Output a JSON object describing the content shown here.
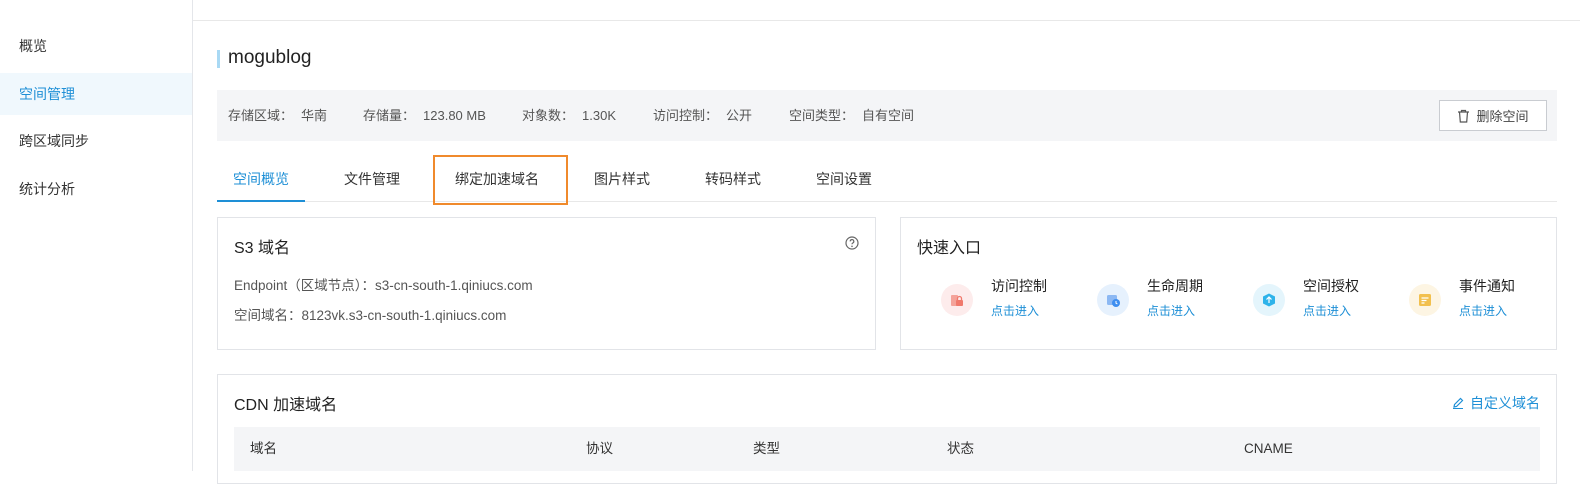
{
  "sidebar": {
    "items": [
      {
        "label": "概览",
        "active": false
      },
      {
        "label": "空间管理",
        "active": true
      },
      {
        "label": "跨区域同步",
        "active": false
      },
      {
        "label": "统计分析",
        "active": false
      }
    ]
  },
  "bucket": {
    "name": "mogublog",
    "info": [
      {
        "label": "存储区域：",
        "value": "华南"
      },
      {
        "label": "存储量：",
        "value": "123.80 MB"
      },
      {
        "label": "对象数：",
        "value": "1.30K"
      },
      {
        "label": "访问控制：",
        "value": "公开"
      },
      {
        "label": "空间类型：",
        "value": "自有空间"
      }
    ],
    "delete_label": "删除空间"
  },
  "tabs": [
    {
      "label": "空间概览",
      "active": true
    },
    {
      "label": "文件管理",
      "active": false
    },
    {
      "label": "绑定加速域名",
      "active": false,
      "highlighted": true
    },
    {
      "label": "图片样式",
      "active": false
    },
    {
      "label": "转码样式",
      "active": false
    },
    {
      "label": "空间设置",
      "active": false
    }
  ],
  "s3": {
    "title": "S3 域名",
    "endpoint": "Endpoint（区域节点）：s3-cn-south-1.qiniucs.com",
    "domain": "空间域名：8123vk.s3-cn-south-1.qiniucs.com"
  },
  "quick": {
    "title": "快速入口",
    "items": [
      {
        "label": "访问控制",
        "link": "点击进入",
        "icon": "access-control-icon",
        "bg": "#fdecec",
        "color": "#f0796c"
      },
      {
        "label": "生命周期",
        "link": "点击进入",
        "icon": "lifecycle-icon",
        "bg": "#e6f1fd",
        "color": "#3d8ef0"
      },
      {
        "label": "空间授权",
        "link": "点击进入",
        "icon": "authorization-icon",
        "bg": "#e4f5fc",
        "color": "#2eb3ea"
      },
      {
        "label": "事件通知",
        "link": "点击进入",
        "icon": "event-notify-icon",
        "bg": "#fdf5e3",
        "color": "#f2c04e"
      }
    ]
  },
  "cdn": {
    "title": "CDN 加速域名",
    "custom_label": "自定义域名",
    "columns": [
      "域名",
      "协议",
      "类型",
      "状态",
      "CNAME"
    ]
  },
  "colors": {
    "accent": "#1e8fd6",
    "highlight": "#f08a2c"
  }
}
